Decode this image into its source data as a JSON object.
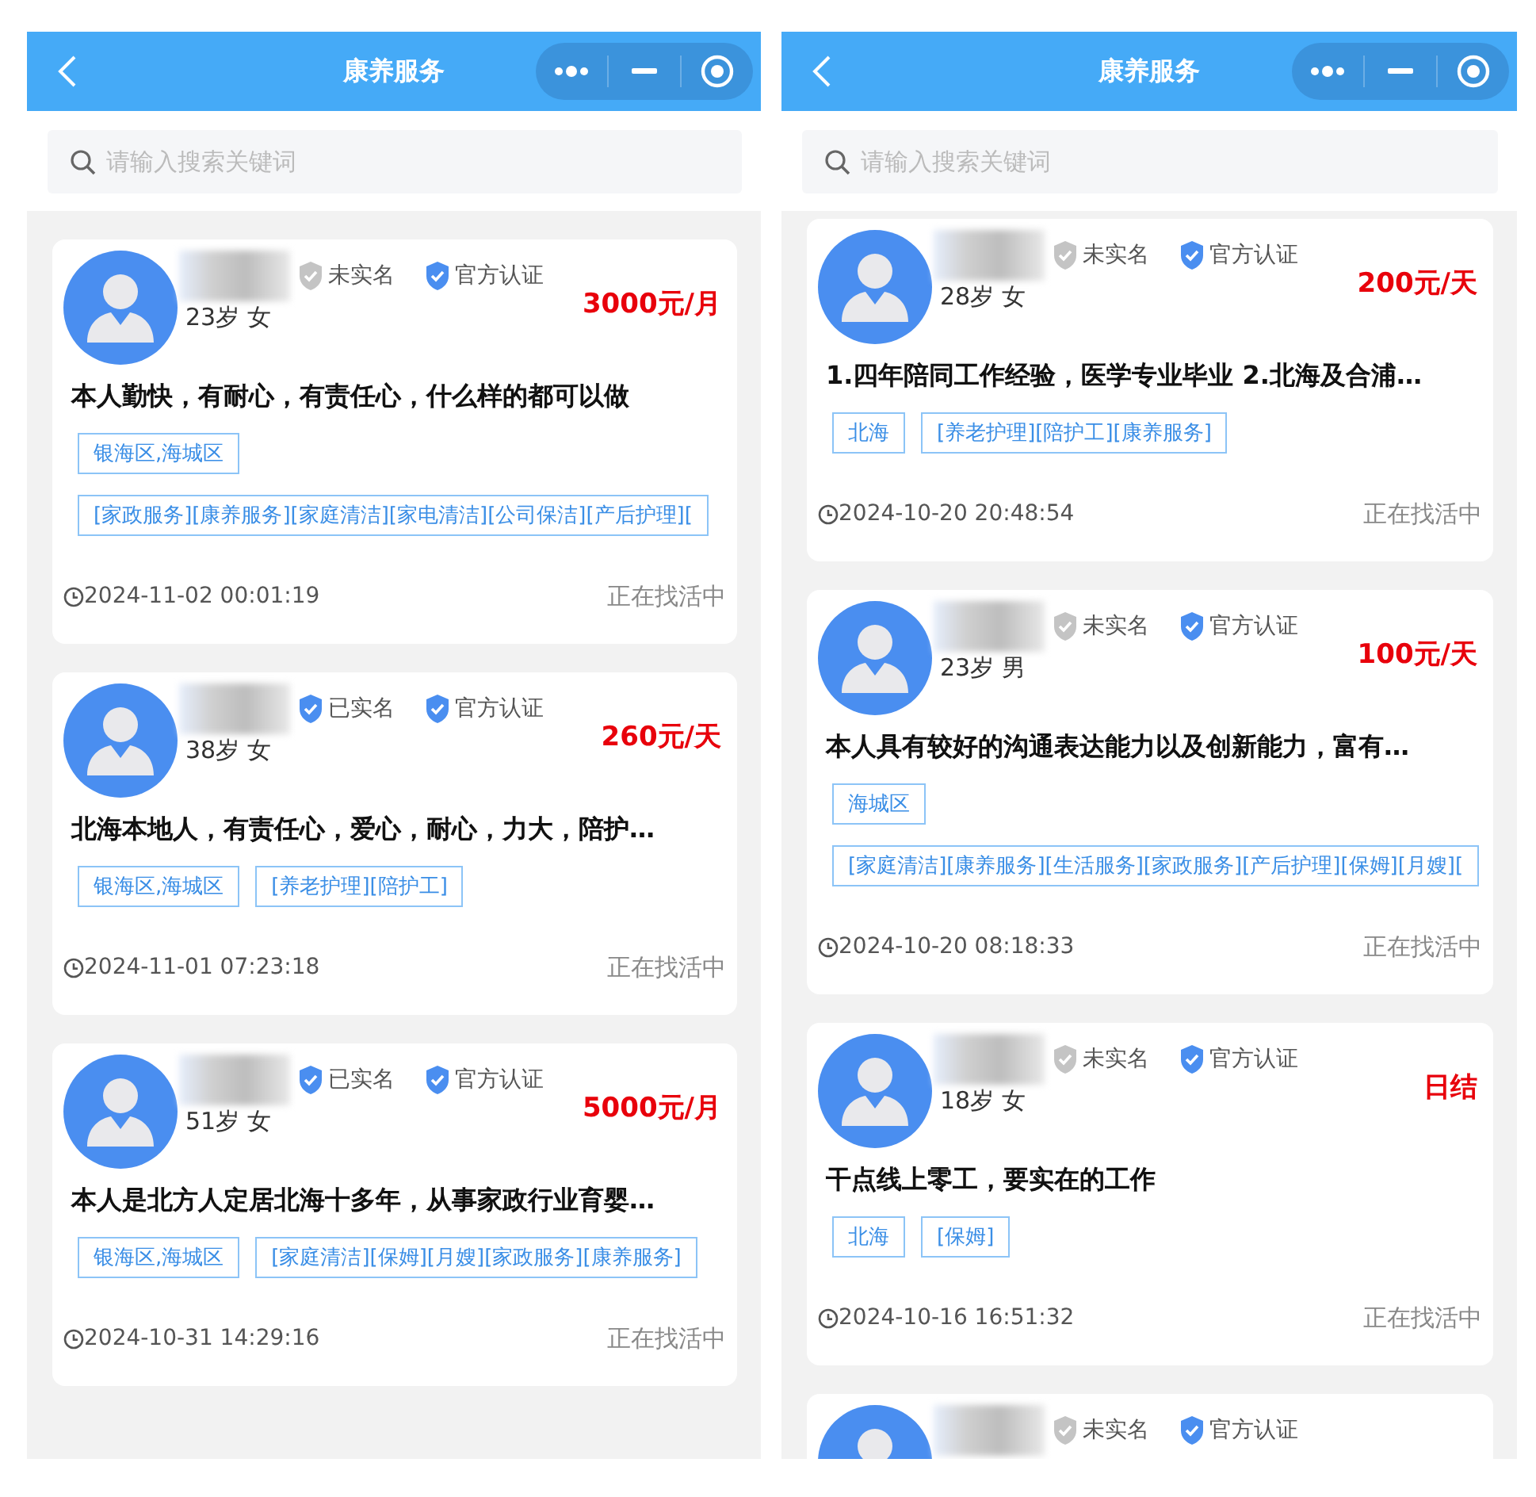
{
  "panels": [
    {
      "title": "康养服务",
      "search": {
        "placeholder": "请输入搜索关键词"
      },
      "cards": [
        {
          "real_name": {
            "label": "未实名",
            "verified": false
          },
          "certification": "官方认证",
          "age_gender": "23岁 女",
          "price": "3000元/月",
          "description": "本人勤快，有耐心，有责任心，什么样的都可以做",
          "tags": [
            "银海区,海城区",
            "[家政服务][康养服务][家庭清洁][家电清洁][公司保洁][产后护理]["
          ],
          "time": "2024-11-02 00:01:19",
          "status": "正在找活中"
        },
        {
          "real_name": {
            "label": "已实名",
            "verified": true
          },
          "certification": "官方认证",
          "age_gender": "38岁 女",
          "price": "260元/天",
          "description": "北海本地人，有责任心，爱心，耐心，力大，陪护…",
          "tags": [
            "银海区,海城区",
            "[养老护理][陪护工]"
          ],
          "time": "2024-11-01 07:23:18",
          "status": "正在找活中"
        },
        {
          "real_name": {
            "label": "已实名",
            "verified": true
          },
          "certification": "官方认证",
          "age_gender": "51岁 女",
          "price": "5000元/月",
          "description": "本人是北方人定居北海十多年，从事家政行业育婴…",
          "tags": [
            "银海区,海城区",
            "[家庭清洁][保姆][月嫂][家政服务][康养服务]"
          ],
          "time": "2024-10-31 14:29:16",
          "status": "正在找活中"
        }
      ]
    },
    {
      "title": "康养服务",
      "search": {
        "placeholder": "请输入搜索关键词"
      },
      "cards": [
        {
          "real_name": {
            "label": "未实名",
            "verified": false
          },
          "certification": "官方认证",
          "age_gender": "28岁 女",
          "price": "200元/天",
          "description": "1.四年陪同工作经验，医学专业毕业 2.北海及合浦…",
          "tags": [
            "北海",
            "[养老护理][陪护工][康养服务]"
          ],
          "time": "2024-10-20 20:48:54",
          "status": "正在找活中"
        },
        {
          "real_name": {
            "label": "未实名",
            "verified": false
          },
          "certification": "官方认证",
          "age_gender": "23岁 男",
          "price": "100元/天",
          "description": "本人具有较好的沟通表达能力以及创新能力，富有…",
          "tags": [
            "海城区",
            "[家庭清洁][康养服务][生活服务][家政服务][产后护理][保姆][月嫂]["
          ],
          "time": "2024-10-20 08:18:33",
          "status": "正在找活中"
        },
        {
          "real_name": {
            "label": "未实名",
            "verified": false
          },
          "certification": "官方认证",
          "age_gender": "18岁 女",
          "price": "日结",
          "description": "干点线上零工，要实在的工作",
          "tags": [
            "北海",
            "[保姆]"
          ],
          "time": "2024-10-16 16:51:32",
          "status": "正在找活中"
        },
        {
          "real_name": {
            "label": "未实名",
            "verified": false
          },
          "certification": "官方认证"
        }
      ]
    }
  ]
}
